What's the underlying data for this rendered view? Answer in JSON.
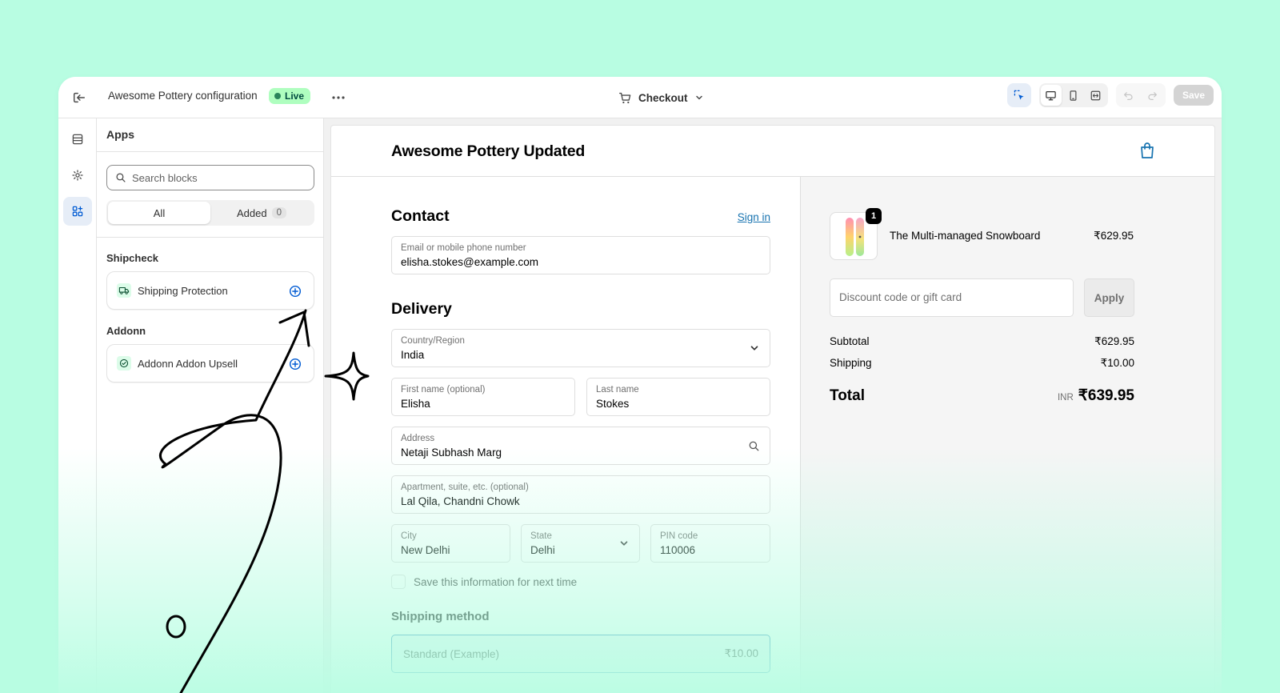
{
  "topbar": {
    "title": "Awesome Pottery configuration",
    "status": "Live",
    "page_selector": "Checkout",
    "save_label": "Save"
  },
  "sidebar": {
    "title": "Apps",
    "search_placeholder": "Search blocks",
    "tabs": [
      {
        "label": "All"
      },
      {
        "label": "Added",
        "count": "0"
      }
    ],
    "groups": [
      {
        "label": "Shipcheck",
        "apps": [
          {
            "name": "Shipping Protection"
          }
        ]
      },
      {
        "label": "Addonn",
        "apps": [
          {
            "name": "Addonn Addon Upsell"
          }
        ]
      }
    ]
  },
  "checkout": {
    "shop_name": "Awesome Pottery Updated",
    "contact": {
      "title": "Contact",
      "sign_in": "Sign in",
      "email_label": "Email or mobile phone number",
      "email_value": "elisha.stokes@example.com"
    },
    "delivery": {
      "title": "Delivery",
      "country_label": "Country/Region",
      "country_value": "India",
      "first_name_label": "First name (optional)",
      "first_name_value": "Elisha",
      "last_name_label": "Last name",
      "last_name_value": "Stokes",
      "address_label": "Address",
      "address_value": "Netaji Subhash Marg",
      "apartment_label": "Apartment, suite, etc. (optional)",
      "apartment_value": "Lal Qila, Chandni Chowk",
      "city_label": "City",
      "city_value": "New Delhi",
      "state_label": "State",
      "state_value": "Delhi",
      "pin_label": "PIN code",
      "pin_value": "110006",
      "save_info": "Save this information for next time"
    },
    "shipping_method": {
      "title": "Shipping method",
      "option_name": "Standard (Example)",
      "option_price": "₹10.00"
    },
    "summary": {
      "item_name": "The Multi-managed Snowboard",
      "item_qty": "1",
      "item_price": "₹629.95",
      "discount_placeholder": "Discount code or gift card",
      "apply_label": "Apply",
      "subtotal_label": "Subtotal",
      "subtotal_value": "₹629.95",
      "shipping_label": "Shipping",
      "shipping_value": "₹10.00",
      "total_label": "Total",
      "currency": "INR",
      "total_value": "₹639.95"
    }
  },
  "colors": {
    "background": "#b8fde2",
    "accent_blue": "#1773b0",
    "live_badge": "#affebf",
    "app_add_icon": "#005bd3"
  }
}
